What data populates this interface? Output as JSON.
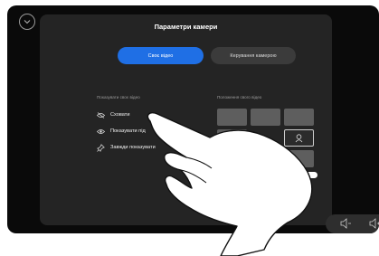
{
  "dialog": {
    "title": "Параметри камери",
    "tabs": [
      {
        "label": "Своє відео",
        "active": true
      },
      {
        "label": "Керування камерою",
        "active": false
      }
    ]
  },
  "self_view": {
    "section_label": "Показувати своє відео",
    "options": [
      {
        "label": "Сховати",
        "icon": "eye-off-icon"
      },
      {
        "label": "Показувати під",
        "icon": "eye-icon"
      },
      {
        "label": "Завжди показувати",
        "icon": "pin-icon"
      }
    ]
  },
  "position": {
    "section_label": "Положення свого відео"
  },
  "colors": {
    "accent": "#1f6fe5",
    "panel": "#242424",
    "background": "#0a0a0a"
  }
}
